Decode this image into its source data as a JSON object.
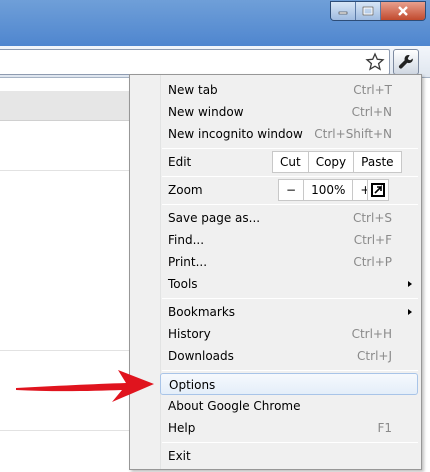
{
  "window_controls": {
    "minimize_icon": "minimize-icon",
    "maximize_icon": "maximize-icon",
    "close_icon": "close-icon"
  },
  "toolbar": {
    "bookmark_star_icon": "star-icon",
    "menu_icon": "wrench-icon"
  },
  "menu": {
    "new_tab": {
      "label": "New tab",
      "shortcut": "Ctrl+T"
    },
    "new_window": {
      "label": "New window",
      "shortcut": "Ctrl+N"
    },
    "new_incognito": {
      "label": "New incognito window",
      "shortcut": "Ctrl+Shift+N"
    },
    "edit": {
      "label": "Edit",
      "cut": "Cut",
      "copy": "Copy",
      "paste": "Paste"
    },
    "zoom": {
      "label": "Zoom",
      "minus": "−",
      "value": "100%",
      "plus": "+",
      "fullscreen_icon": "fullscreen-icon"
    },
    "save_page": {
      "label": "Save page as...",
      "shortcut": "Ctrl+S"
    },
    "find": {
      "label": "Find...",
      "shortcut": "Ctrl+F"
    },
    "print": {
      "label": "Print...",
      "shortcut": "Ctrl+P"
    },
    "tools": {
      "label": "Tools"
    },
    "bookmarks": {
      "label": "Bookmarks"
    },
    "history": {
      "label": "History",
      "shortcut": "Ctrl+H"
    },
    "downloads": {
      "label": "Downloads",
      "shortcut": "Ctrl+J"
    },
    "options": {
      "label": "Options"
    },
    "about": {
      "label": "About Google Chrome"
    },
    "help": {
      "label": "Help",
      "shortcut": "F1"
    },
    "exit": {
      "label": "Exit"
    }
  },
  "annotation": {
    "arrow_color": "#e0141e",
    "icon": "red-arrow-icon"
  }
}
